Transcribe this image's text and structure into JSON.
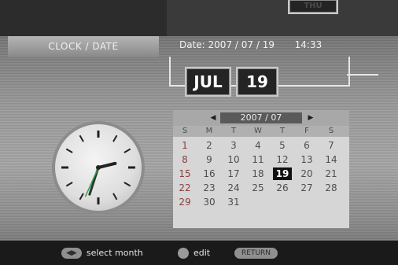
{
  "header": {
    "title": "CLOCK / DATE",
    "date_label": "Date: 2007 / 07 / 19",
    "time_label": "14:33"
  },
  "date_chips": {
    "month": "JUL",
    "day": "19",
    "weekday": "THU"
  },
  "calendar": {
    "title": "2007 / 07",
    "prev_icon": "triangle-left",
    "next_icon": "triangle-right",
    "weekdays": [
      "S",
      "M",
      "T",
      "W",
      "T",
      "F",
      "S"
    ],
    "first_weekday_index": 0,
    "days": [
      "1",
      "2",
      "3",
      "4",
      "5",
      "6",
      "7",
      "8",
      "9",
      "10",
      "11",
      "12",
      "13",
      "14",
      "15",
      "16",
      "17",
      "18",
      "19",
      "20",
      "21",
      "22",
      "23",
      "24",
      "25",
      "26",
      "27",
      "28",
      "29",
      "30",
      "31"
    ],
    "selected_day": "19"
  },
  "clock": {
    "hour": 2,
    "minute": 33,
    "second": 34
  },
  "footer": {
    "select_month_icon": "arrows-lr-pill",
    "select_month": "select month",
    "edit_icon": "ok-button",
    "edit": "edit",
    "return_button": "RETURN"
  }
}
